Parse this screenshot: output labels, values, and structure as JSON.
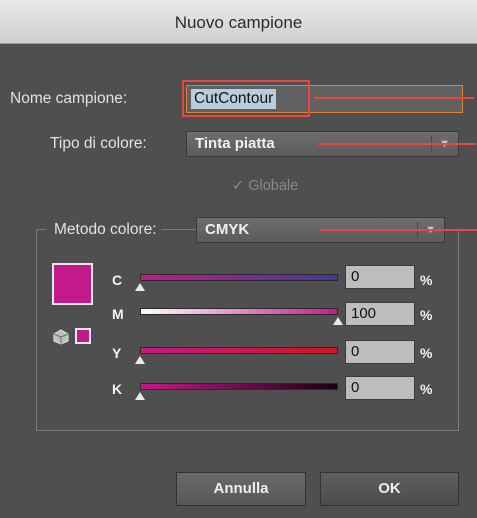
{
  "dialog": {
    "title": "Nuovo campione"
  },
  "name": {
    "label": "Nome campione:",
    "value": "CutContour"
  },
  "color_type": {
    "label": "Tipo di colore:",
    "value": "Tinta piatta"
  },
  "global": {
    "label": "Globale",
    "checked": true
  },
  "color_mode": {
    "label": "Metodo colore:",
    "value": "CMYK"
  },
  "swatch_color": "#c4198a",
  "channels": [
    {
      "label": "C",
      "value": "0",
      "unit": "%"
    },
    {
      "label": "M",
      "value": "100",
      "unit": "%"
    },
    {
      "label": "Y",
      "value": "0",
      "unit": "%"
    },
    {
      "label": "K",
      "value": "0",
      "unit": "%"
    }
  ],
  "buttons": {
    "cancel": "Annulla",
    "ok": "OK"
  },
  "annotation_color": "#e8463f"
}
